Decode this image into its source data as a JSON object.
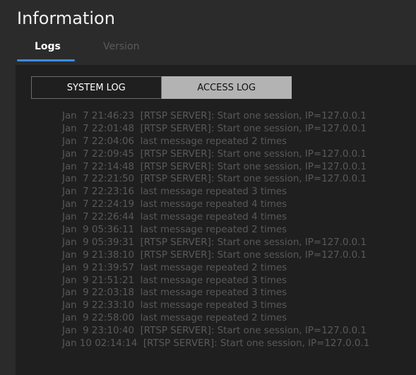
{
  "header": {
    "title": "Information"
  },
  "tabs": [
    {
      "label": "Logs",
      "active": true
    },
    {
      "label": "Version",
      "active": false
    }
  ],
  "log_toggle": {
    "system_label": "SYSTEM LOG",
    "access_label": "ACCESS LOG",
    "selected": "ACCESS LOG"
  },
  "colors": {
    "accent": "#3d8be6",
    "background": "#2b2b2b",
    "panel": "#1f1f1f",
    "log_text": "#595959"
  },
  "log_lines": [
    "Jan  7 21:46:23  [RTSP SERVER]: Start one session, IP=127.0.0.1",
    "Jan  7 22:01:48  [RTSP SERVER]: Start one session, IP=127.0.0.1",
    "Jan  7 22:04:06  last message repeated 2 times",
    "Jan  7 22:09:45  [RTSP SERVER]: Start one session, IP=127.0.0.1",
    "Jan  7 22:14:48  [RTSP SERVER]: Start one session, IP=127.0.0.1",
    "Jan  7 22:21:50  [RTSP SERVER]: Start one session, IP=127.0.0.1",
    "Jan  7 22:23:16  last message repeated 3 times",
    "Jan  7 22:24:19  last message repeated 4 times",
    "Jan  7 22:26:44  last message repeated 4 times",
    "Jan  9 05:36:11  last message repeated 2 times",
    "Jan  9 05:39:31  [RTSP SERVER]: Start one session, IP=127.0.0.1",
    "Jan  9 21:38:10  [RTSP SERVER]: Start one session, IP=127.0.0.1",
    "Jan  9 21:39:57  last message repeated 2 times",
    "Jan  9 21:51:21  last message repeated 3 times",
    "Jan  9 22:03:18  last message repeated 3 times",
    "Jan  9 22:33:10  last message repeated 3 times",
    "Jan  9 22:58:00  last message repeated 2 times",
    "Jan  9 23:10:40  [RTSP SERVER]: Start one session, IP=127.0.0.1",
    "Jan 10 02:14:14  [RTSP SERVER]: Start one session, IP=127.0.0.1"
  ]
}
